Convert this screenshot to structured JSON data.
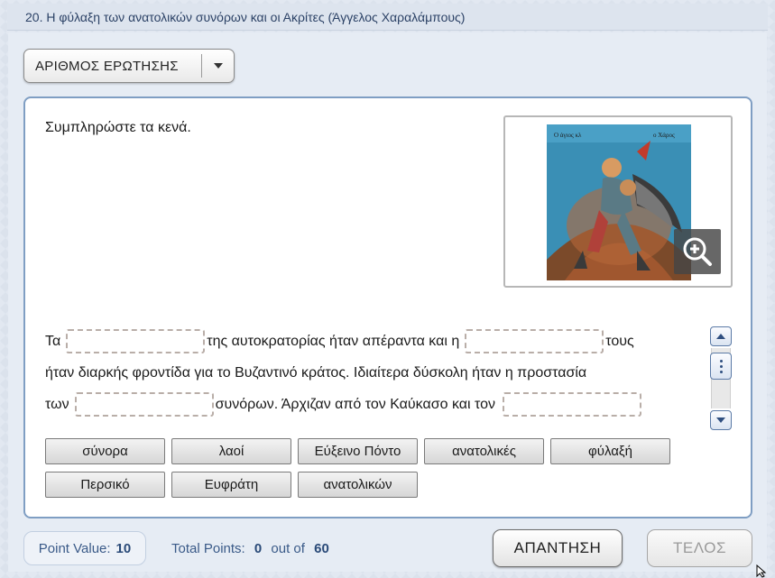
{
  "title": "20. Η φύλαξη των ανατολικών συνόρων και οι Ακρίτες  (Άγγελος Χαραλάμπους)",
  "question_dropdown": {
    "label": "ΑΡΙΘΜΟΣ ΕΡΩΤΗΣΗΣ"
  },
  "question": {
    "instruction": "Συμπληρώστε τα κενά.",
    "image": {
      "caption_left": "Ο άγιος κλ",
      "caption_right": "ο Χάρος",
      "zoom_icon": "zoom-in-icon"
    },
    "lines": [
      {
        "segments": [
          "Τα",
          "__blank__",
          "της αυτοκρατορίας ήταν απέραντα και η",
          "__blank__",
          "τους"
        ]
      },
      {
        "segments": [
          "ήταν διαρκής φροντίδα για το Βυζαντινό κράτος. Ιδιαίτερα δύσκολη ήταν η προστασία"
        ]
      },
      {
        "segments": [
          "των",
          "__blank__",
          "συνόρων. Άρχιζαν από τον Καύκασο και τον",
          "__blank__"
        ]
      }
    ]
  },
  "word_bank": [
    "σύνορα",
    "λαοί",
    "Εύξεινο Πόντο",
    "ανατολικές",
    "φύλαξή",
    "Περσικό",
    "Ευφράτη",
    "ανατολικών"
  ],
  "footer": {
    "point_value_label": "Point Value:",
    "point_value": "10",
    "total_label": "Total Points:",
    "total_points": "0",
    "out_of_label": "out of",
    "max_points": "60",
    "answer_button": "ΑΠΑΝΤΗΣΗ",
    "end_button": "ΤΕΛΟΣ"
  },
  "colors": {
    "accent": "#7f9ec3",
    "text_blue": "#3a5a88",
    "background": "#e2e8f1"
  }
}
